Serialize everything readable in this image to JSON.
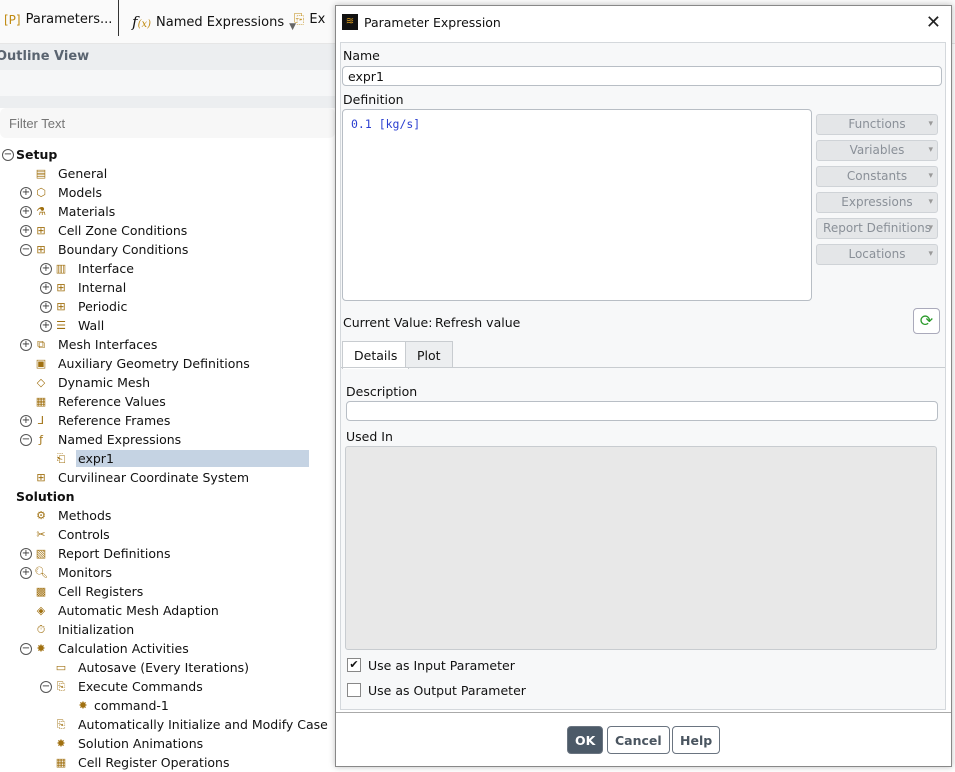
{
  "toolbar": {
    "parameters": "Parameters...",
    "named_expressions": "Named Expressions",
    "ex": "Ex"
  },
  "outline": {
    "title": "Outline View",
    "filter_placeholder": "Filter Text"
  },
  "tree": [
    {
      "label": "Setup",
      "level": 0,
      "exp": "-",
      "bold": true
    },
    {
      "label": "General",
      "level": 1,
      "exp": "",
      "icon": "general-icon"
    },
    {
      "label": "Models",
      "level": 1,
      "exp": "+",
      "icon": "models-icon"
    },
    {
      "label": "Materials",
      "level": 1,
      "exp": "+",
      "icon": "materials-icon"
    },
    {
      "label": "Cell Zone Conditions",
      "level": 1,
      "exp": "+",
      "icon": "grid-icon"
    },
    {
      "label": "Boundary Conditions",
      "level": 1,
      "exp": "-",
      "icon": "grid-icon"
    },
    {
      "label": "Interface",
      "level": 2,
      "exp": "+",
      "icon": "interface-icon"
    },
    {
      "label": "Internal",
      "level": 2,
      "exp": "+",
      "icon": "grid-icon"
    },
    {
      "label": "Periodic",
      "level": 2,
      "exp": "+",
      "icon": "grid-icon"
    },
    {
      "label": "Wall",
      "level": 2,
      "exp": "+",
      "icon": "wall-icon"
    },
    {
      "label": "Mesh Interfaces",
      "level": 1,
      "exp": "+",
      "icon": "mesh-interfaces-icon"
    },
    {
      "label": "Auxiliary Geometry Definitions",
      "level": 1,
      "exp": "",
      "icon": "box-icon"
    },
    {
      "label": "Dynamic Mesh",
      "level": 1,
      "exp": "",
      "icon": "dynamic-mesh-icon"
    },
    {
      "label": "Reference Values",
      "level": 1,
      "exp": "",
      "icon": "reference-values-icon"
    },
    {
      "label": "Reference Frames",
      "level": 1,
      "exp": "+",
      "icon": "axes-icon"
    },
    {
      "label": "Named Expressions",
      "level": 1,
      "exp": "-",
      "icon": "function-icon"
    },
    {
      "label": "expr1",
      "level": 2,
      "exp": "",
      "icon": "parameter-icon",
      "selected": true
    },
    {
      "label": "Curvilinear Coordinate System",
      "level": 1,
      "exp": "",
      "icon": "grid-icon"
    },
    {
      "label": "Solution",
      "level": 0,
      "exp": "",
      "bold": true
    },
    {
      "label": "Methods",
      "level": 1,
      "exp": "",
      "icon": "methods-icon"
    },
    {
      "label": "Controls",
      "level": 1,
      "exp": "",
      "icon": "controls-icon"
    },
    {
      "label": "Report Definitions",
      "level": 1,
      "exp": "+",
      "icon": "report-icon"
    },
    {
      "label": "Monitors",
      "level": 1,
      "exp": "+",
      "icon": "search-icon"
    },
    {
      "label": "Cell Registers",
      "level": 1,
      "exp": "",
      "icon": "cell-registers-icon"
    },
    {
      "label": "Automatic Mesh Adaption",
      "level": 1,
      "exp": "",
      "icon": "mesh-adaption-icon"
    },
    {
      "label": "Initialization",
      "level": 1,
      "exp": "",
      "icon": "initialization-icon"
    },
    {
      "label": "Calculation Activities",
      "level": 1,
      "exp": "-",
      "icon": "activities-icon"
    },
    {
      "label": "Autosave (Every Iterations)",
      "level": 2,
      "exp": "",
      "icon": "save-icon"
    },
    {
      "label": "Execute Commands",
      "level": 2,
      "exp": "-",
      "icon": "execute-icon"
    },
    {
      "label": "command-1",
      "level": 3,
      "exp": "",
      "icon": "command-icon"
    },
    {
      "label": "Automatically Initialize and Modify Case",
      "level": 2,
      "exp": "",
      "icon": "execute-icon"
    },
    {
      "label": "Solution Animations",
      "level": 2,
      "exp": "",
      "icon": "animation-icon"
    },
    {
      "label": "Cell Register Operations",
      "level": 2,
      "exp": "",
      "icon": "table-icon"
    }
  ],
  "dialog": {
    "title": "Parameter Expression",
    "name_label": "Name",
    "name_value": "expr1",
    "definition_label": "Definition",
    "definition_value": "0.1 [kg/s]",
    "side_buttons": [
      "Functions",
      "Variables",
      "Constants",
      "Expressions",
      "Report Definitions",
      "Locations"
    ],
    "current_value_label": "Current Value:",
    "current_value": "Refresh value",
    "tabs": [
      "Details",
      "Plot"
    ],
    "description_label": "Description",
    "description_value": "",
    "used_in_label": "Used In",
    "use_input": "Use as Input Parameter",
    "use_input_checked": true,
    "use_output": "Use as Output Parameter",
    "use_output_checked": false,
    "ok": "OK",
    "cancel": "Cancel",
    "help": "Help"
  }
}
